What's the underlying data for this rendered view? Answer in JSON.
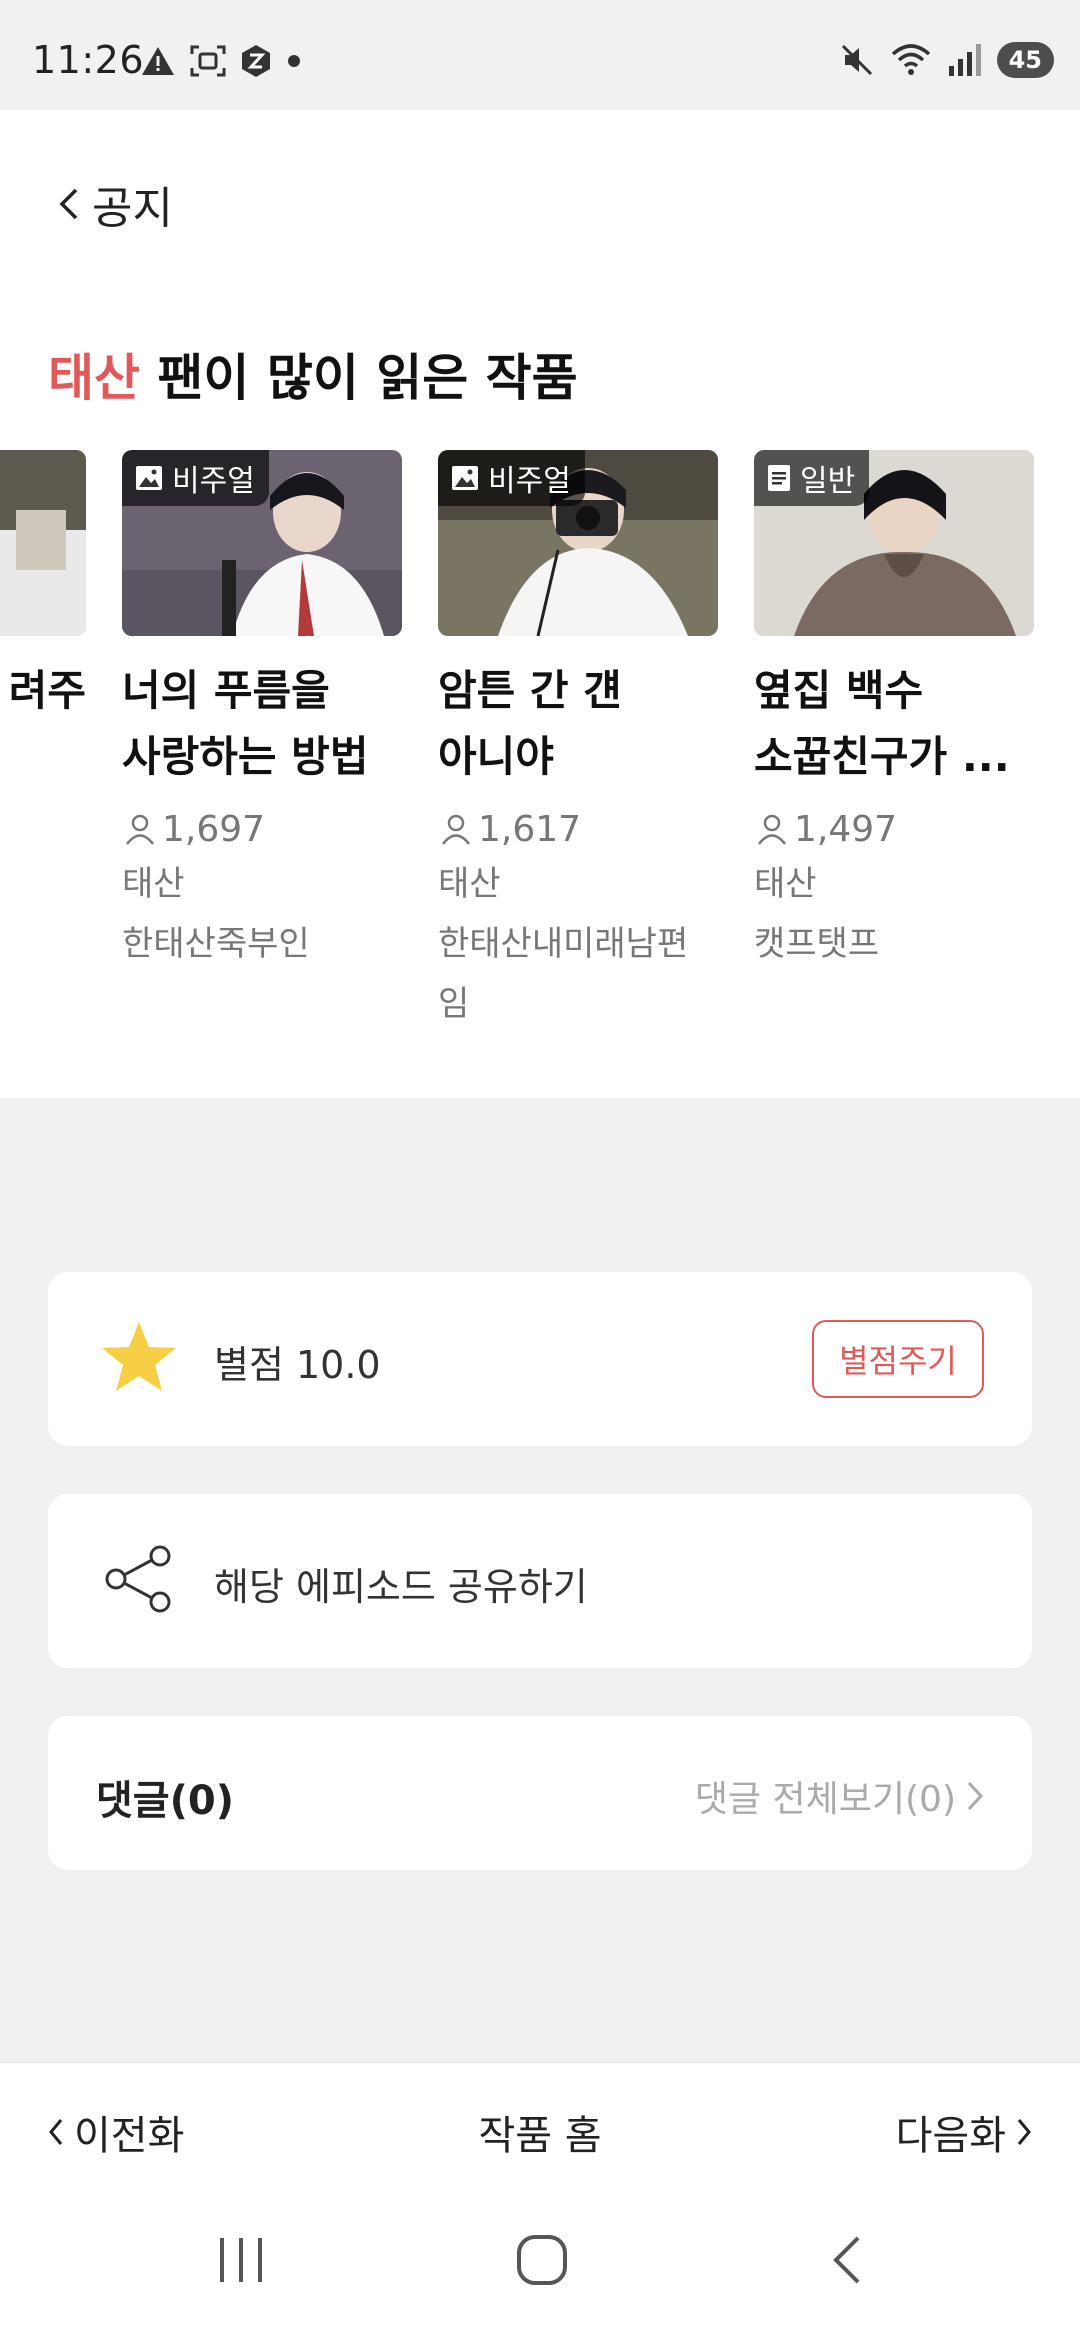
{
  "status_bar": {
    "time": "11:26",
    "battery": "45",
    "icons": [
      "warning-icon",
      "screenshot-icon",
      "z-app-icon",
      "dot-icon",
      "mute-icon",
      "wifi-icon",
      "signal-icon",
      "battery-icon"
    ]
  },
  "header": {
    "back_label": "공지"
  },
  "recommend": {
    "title_highlight": "태산",
    "title_rest": " 팬이 많이 읽은 작품",
    "partial_card_title": "려주",
    "cards": [
      {
        "badge": "비주얼",
        "badge_icon": "image-icon",
        "title": "너의 푸름을\n사랑하는 방법",
        "views": "1,697",
        "genre": "태산",
        "author": "한태산죽부인"
      },
      {
        "badge": "비주얼",
        "badge_icon": "image-icon",
        "title": "암튼 간 걘\n아니야",
        "views": "1,617",
        "genre": "태산",
        "author": "한태산내미래남편\n임"
      },
      {
        "badge": "일반",
        "badge_icon": "document-icon",
        "title": "옆집 백수\n소꿉친구가 ...",
        "views": "1,497",
        "genre": "태산",
        "author": "캣프탯프"
      }
    ]
  },
  "rating": {
    "label": "별점 10.0",
    "button": "별점주기",
    "accent": "#e05a59",
    "star_color": "#f7cf45"
  },
  "share": {
    "label": "해당 에피소드 공유하기"
  },
  "comments": {
    "title": "댓글(0)",
    "link": "댓글 전체보기(0)"
  },
  "bottom_nav": {
    "prev": "이전화",
    "home": "작품 홈",
    "next": "다음화"
  }
}
